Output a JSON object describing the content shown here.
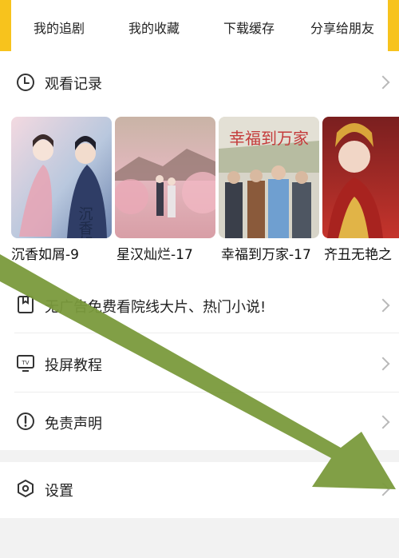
{
  "colors": {
    "accent": "#f7c31d",
    "arrow": "#7a9a3c",
    "divider": "#ededed",
    "page_bg": "#f2f2f2"
  },
  "top_tabs": [
    {
      "label": "我的追剧"
    },
    {
      "label": "我的收藏"
    },
    {
      "label": "下载缓存"
    },
    {
      "label": "分享给朋友"
    }
  ],
  "history": {
    "icon": "clock-icon",
    "label": "观看记录"
  },
  "posters": [
    {
      "title": "沉香如屑-9",
      "image_text": "沉香如屑"
    },
    {
      "title": "星汉灿烂-17"
    },
    {
      "title": "幸福到万家-17",
      "image_text": "幸福到万家"
    },
    {
      "title": "齐丑无艳之"
    }
  ],
  "menu": [
    {
      "icon": "bookmark-icon",
      "label": "无广告免费看院线大片、热门小说!"
    },
    {
      "icon": "tv-icon",
      "label": "投屏教程"
    },
    {
      "icon": "alert-icon",
      "label": "免责声明"
    }
  ],
  "settings": {
    "icon": "settings-icon",
    "label": "设置"
  }
}
